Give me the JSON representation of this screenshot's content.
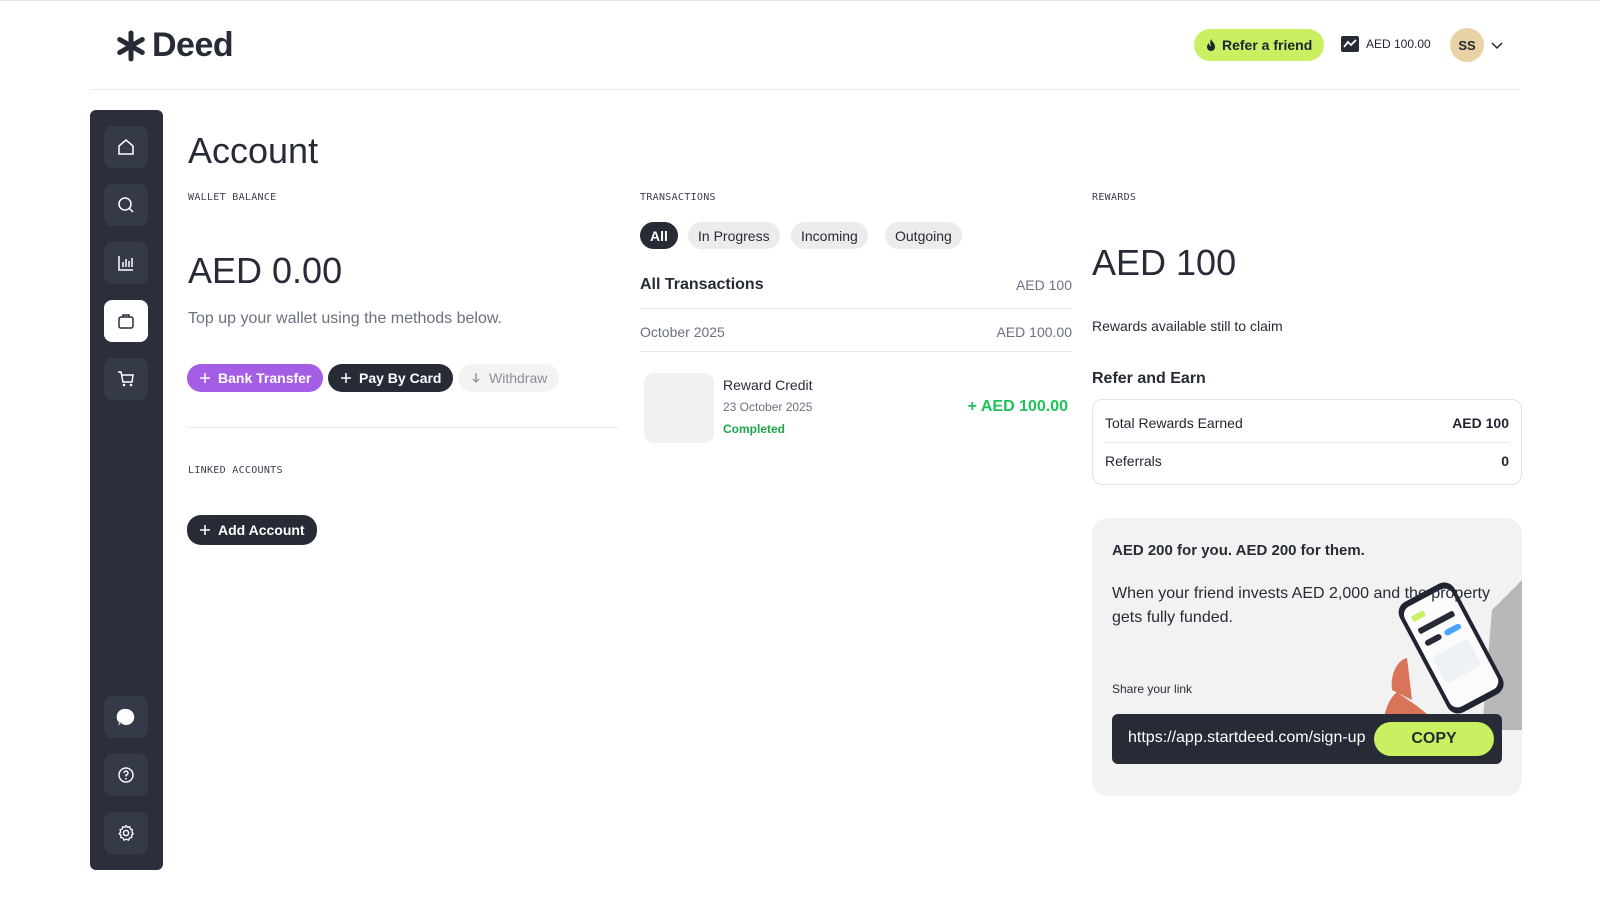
{
  "header": {
    "logo_text": "Deed",
    "refer_label": "Refer a friend",
    "balance": "AED 100.00",
    "avatar_initials": "SS"
  },
  "page": {
    "title": "Account"
  },
  "wallet": {
    "label": "WALLET BALANCE",
    "amount": "AED 0.00",
    "hint": "Top up your wallet using the methods below.",
    "bank_transfer": "Bank Transfer",
    "pay_by_card": "Pay By Card",
    "withdraw": "Withdraw"
  },
  "linked": {
    "label": "LINKED ACCOUNTS",
    "add_account": "Add Account"
  },
  "transactions": {
    "label": "TRANSACTIONS",
    "tabs": [
      "All",
      "In Progress",
      "Incoming",
      "Outgoing"
    ],
    "all_label": "All Transactions",
    "all_total": "AED 100",
    "month": "October 2025",
    "month_total": "AED 100.00",
    "items": [
      {
        "title": "Reward Credit",
        "date": "23 October 2025",
        "status": "Completed",
        "amount": "+ AED 100.00"
      }
    ]
  },
  "rewards": {
    "label": "REWARDS",
    "amount": "AED 100",
    "subtitle": "Rewards available still to claim",
    "refer_heading": "Refer and Earn",
    "total_label": "Total Rewards Earned",
    "total_value": "AED 100",
    "referrals_label": "Referrals",
    "referrals_value": "0",
    "promo_title": "AED 200 for you. AED 200 for them.",
    "promo_body": "When your friend invests AED 2,000 and the property gets fully funded.",
    "share_label": "Share your link",
    "share_link": "https://app.startdeed.com/sign-up",
    "copy_label": "COPY"
  },
  "colors": {
    "accent_lime": "#c8f060",
    "accent_purple": "#a45ee6",
    "dark": "#262b36",
    "success": "#1ec25a"
  }
}
